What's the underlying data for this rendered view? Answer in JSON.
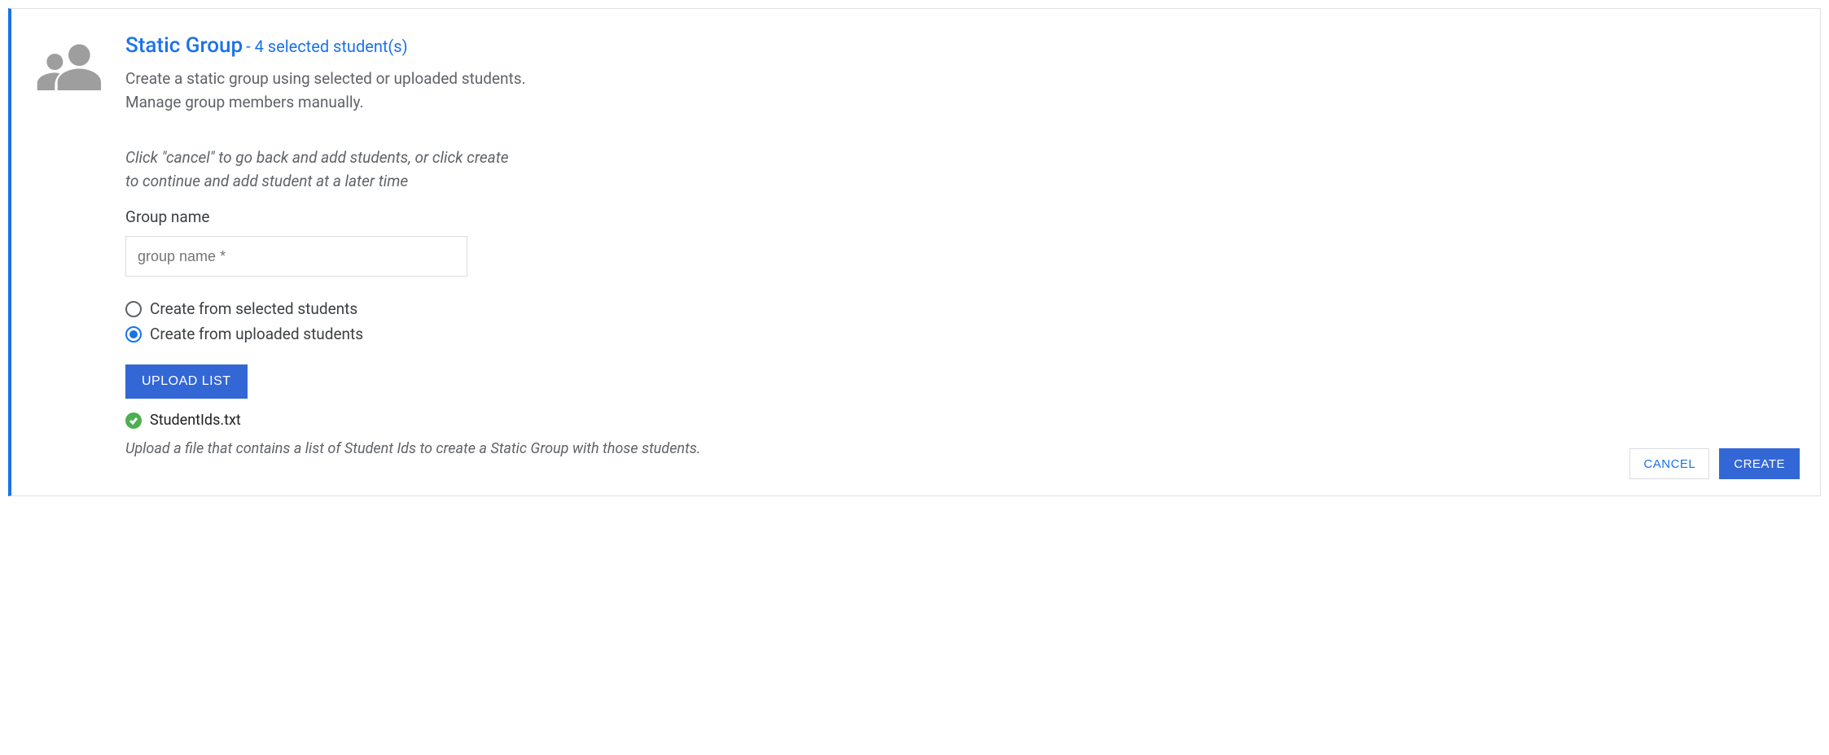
{
  "header": {
    "title": "Static Group",
    "suffix": "- 4 selected student(s)",
    "description": "Create a static group using selected or uploaded students. Manage group members manually."
  },
  "form": {
    "hint": "Click \"cancel\" to go back and add students, or click create to continue and add student at a later time",
    "group_name_label": "Group name",
    "group_name_placeholder": "group name *",
    "radio_selected_label": "Create from selected students",
    "radio_uploaded_label": "Create from uploaded students",
    "selected_option": "uploaded",
    "upload_button": "UPLOAD LIST",
    "uploaded_file": "StudentIds.txt",
    "upload_hint": "Upload a file that contains a list of Student Ids to create a Static Group with those students."
  },
  "footer": {
    "cancel": "CANCEL",
    "create": "CREATE"
  }
}
